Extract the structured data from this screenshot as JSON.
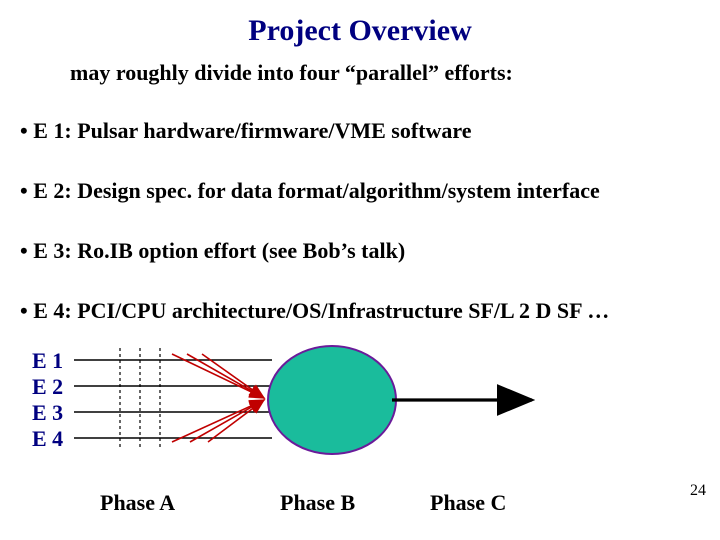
{
  "title": "Project Overview",
  "subtitle": "may roughly divide into four “parallel” efforts:",
  "bullets": [
    "• E 1: Pulsar hardware/firmware/VME software",
    "• E 2: Design spec. for data format/algorithm/system interface",
    "• E 3: Ro.IB option effort (see Bob’s talk)",
    "• E 4: PCI/CPU architecture/OS/Infrastructure SF/L 2 D SF …"
  ],
  "diagram": {
    "rows": [
      "E 1",
      "E 2",
      "E 3",
      "E 4"
    ],
    "phases": [
      "Phase A",
      "Phase B",
      "Phase C"
    ],
    "circle_color": "#1ABC9C",
    "circle_stroke": "#6a1b9a",
    "arrow_color": "#000000",
    "row_label_color": "#000080"
  },
  "page_number": "24"
}
